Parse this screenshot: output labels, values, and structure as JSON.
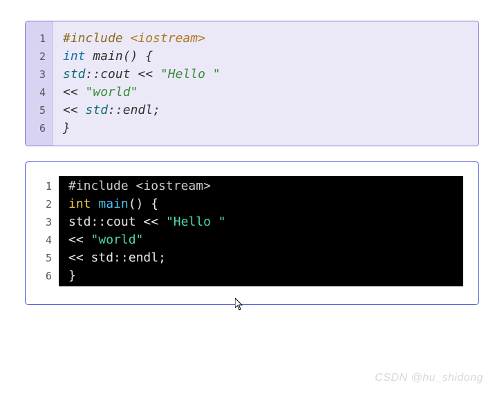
{
  "blocks": [
    {
      "theme": "light",
      "lines": [
        [
          {
            "cls": "tok-pp",
            "t": "#include"
          },
          {
            "cls": "",
            "t": " "
          },
          {
            "cls": "tok-inc",
            "t": "<iostream>"
          }
        ],
        [
          {
            "cls": "tok-kw",
            "t": "int"
          },
          {
            "cls": "",
            "t": " "
          },
          {
            "cls": "tok-fn",
            "t": "main"
          },
          {
            "cls": "tok-punc",
            "t": "() {"
          }
        ],
        [
          {
            "cls": "tok-ns",
            "t": "std"
          },
          {
            "cls": "tok-op",
            "t": "::"
          },
          {
            "cls": "tok-id",
            "t": "cout"
          },
          {
            "cls": "",
            "t": " "
          },
          {
            "cls": "tok-op",
            "t": "<<"
          },
          {
            "cls": "",
            "t": " "
          },
          {
            "cls": "tok-str",
            "t": "\"Hello \""
          }
        ],
        [
          {
            "cls": "tok-op",
            "t": "<<"
          },
          {
            "cls": "",
            "t": " "
          },
          {
            "cls": "tok-str",
            "t": "\"world\""
          }
        ],
        [
          {
            "cls": "tok-op",
            "t": "<<"
          },
          {
            "cls": "",
            "t": " "
          },
          {
            "cls": "tok-ns",
            "t": "std"
          },
          {
            "cls": "tok-op",
            "t": "::"
          },
          {
            "cls": "tok-id",
            "t": "endl"
          },
          {
            "cls": "tok-punc",
            "t": ";"
          }
        ],
        [
          {
            "cls": "tok-punc",
            "t": "}"
          }
        ]
      ]
    },
    {
      "theme": "dark",
      "lines": [
        [
          {
            "cls": "tok-pp",
            "t": "#include"
          },
          {
            "cls": "",
            "t": " "
          },
          {
            "cls": "tok-inc",
            "t": "<iostream>"
          }
        ],
        [
          {
            "cls": "tok-kw",
            "t": "int"
          },
          {
            "cls": "",
            "t": " "
          },
          {
            "cls": "tok-fn",
            "t": "main"
          },
          {
            "cls": "tok-punc",
            "t": "() {"
          }
        ],
        [
          {
            "cls": "tok-ns",
            "t": "std"
          },
          {
            "cls": "tok-op",
            "t": "::"
          },
          {
            "cls": "tok-id",
            "t": "cout"
          },
          {
            "cls": "",
            "t": " "
          },
          {
            "cls": "tok-op",
            "t": "<<"
          },
          {
            "cls": "",
            "t": " "
          },
          {
            "cls": "tok-str",
            "t": "\"Hello \""
          }
        ],
        [
          {
            "cls": "tok-op",
            "t": "<<"
          },
          {
            "cls": "",
            "t": " "
          },
          {
            "cls": "tok-str",
            "t": "\"world\""
          }
        ],
        [
          {
            "cls": "tok-op",
            "t": "<<"
          },
          {
            "cls": "",
            "t": " "
          },
          {
            "cls": "tok-ns",
            "t": "std"
          },
          {
            "cls": "tok-op",
            "t": "::"
          },
          {
            "cls": "tok-id",
            "t": "endl"
          },
          {
            "cls": "tok-punc",
            "t": ";"
          }
        ],
        [
          {
            "cls": "tok-punc",
            "t": "}"
          }
        ]
      ]
    }
  ],
  "watermark": "CSDN @hu_shidong"
}
